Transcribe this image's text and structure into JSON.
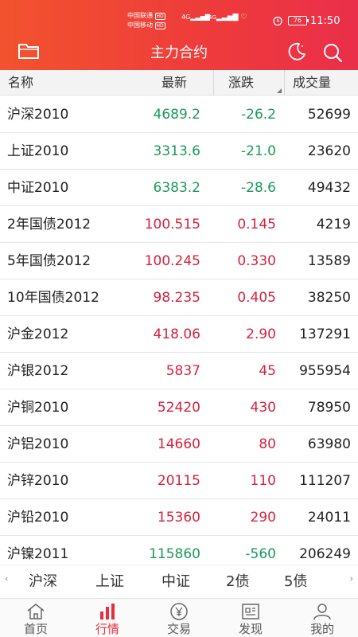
{
  "status": {
    "carrier1": "中国联通",
    "carrier2": "中国移动",
    "hd1": "HD",
    "hd2": "HD",
    "net1": "4G",
    "net2": "4G",
    "battery": "76",
    "time": "11:50"
  },
  "header": {
    "title": "主力合约"
  },
  "columns": {
    "name": "名称",
    "last": "最新",
    "change": "涨跌",
    "volume": "成交量"
  },
  "rows": [
    {
      "name": "沪深2010",
      "last": "4689.2",
      "change": "-26.2",
      "volume": "52699",
      "dir": "down"
    },
    {
      "name": "上证2010",
      "last": "3313.6",
      "change": "-21.0",
      "volume": "23620",
      "dir": "down"
    },
    {
      "name": "中证2010",
      "last": "6383.2",
      "change": "-28.6",
      "volume": "49432",
      "dir": "down"
    },
    {
      "name": "2年国债2012",
      "last": "100.515",
      "change": "0.145",
      "volume": "4219",
      "dir": "up"
    },
    {
      "name": "5年国债2012",
      "last": "100.245",
      "change": "0.330",
      "volume": "13589",
      "dir": "up"
    },
    {
      "name": "10年国债2012",
      "last": "98.235",
      "change": "0.405",
      "volume": "38250",
      "dir": "up"
    },
    {
      "name": "沪金2012",
      "last": "418.06",
      "change": "2.90",
      "volume": "137291",
      "dir": "up"
    },
    {
      "name": "沪银2012",
      "last": "5837",
      "change": "45",
      "volume": "955954",
      "dir": "up"
    },
    {
      "name": "沪铜2010",
      "last": "52420",
      "change": "430",
      "volume": "78950",
      "dir": "up"
    },
    {
      "name": "沪铝2010",
      "last": "14660",
      "change": "80",
      "volume": "63980",
      "dir": "up"
    },
    {
      "name": "沪锌2010",
      "last": "20115",
      "change": "110",
      "volume": "111207",
      "dir": "up"
    },
    {
      "name": "沪铅2010",
      "last": "15360",
      "change": "290",
      "volume": "24011",
      "dir": "up"
    },
    {
      "name": "沪镍2011",
      "last": "115860",
      "change": "-560",
      "volume": "206249",
      "dir": "down"
    }
  ],
  "market_tabs": [
    "沪深",
    "上证",
    "中证",
    "2债",
    "5债"
  ],
  "nav": {
    "home": "首页",
    "quotes": "行情",
    "trade": "交易",
    "discover": "发现",
    "mine": "我的"
  },
  "colors": {
    "accent": "#ee3a3c",
    "up": "#d8213e",
    "down": "#1a9a5b"
  }
}
